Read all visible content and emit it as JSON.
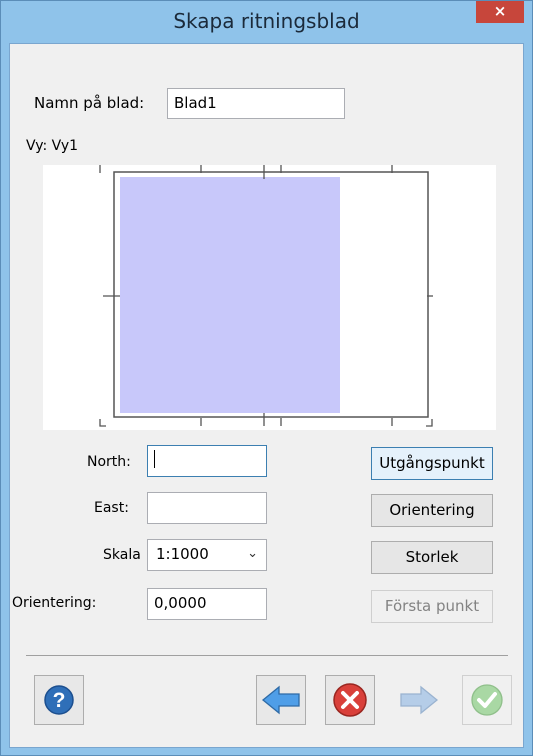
{
  "window": {
    "title": "Skapa ritningsblad",
    "close_glyph": "×"
  },
  "sheet": {
    "name_label": "Namn på blad:",
    "name_value": "Blad1",
    "view_label": "Vy: Vy1"
  },
  "fields": {
    "north_label": "North:",
    "north_value": "",
    "east_label": "East:",
    "east_value": "",
    "scale_label": "Skala",
    "scale_value": "1:1000",
    "orientation_label": "Orientering:",
    "orientation_value": "0,0000"
  },
  "buttons": {
    "origin": "Utgångspunkt",
    "orientation": "Orientering",
    "size": "Storlek",
    "first_point": "Första punkt"
  },
  "footer_icons": [
    "help-icon",
    "back-arrow-icon",
    "cancel-icon",
    "forward-arrow-icon",
    "ok-check-icon"
  ],
  "colors": {
    "titlebar": "#8fc3ea",
    "sheet_fill": "#c8c8fa",
    "close": "#c7463b"
  }
}
